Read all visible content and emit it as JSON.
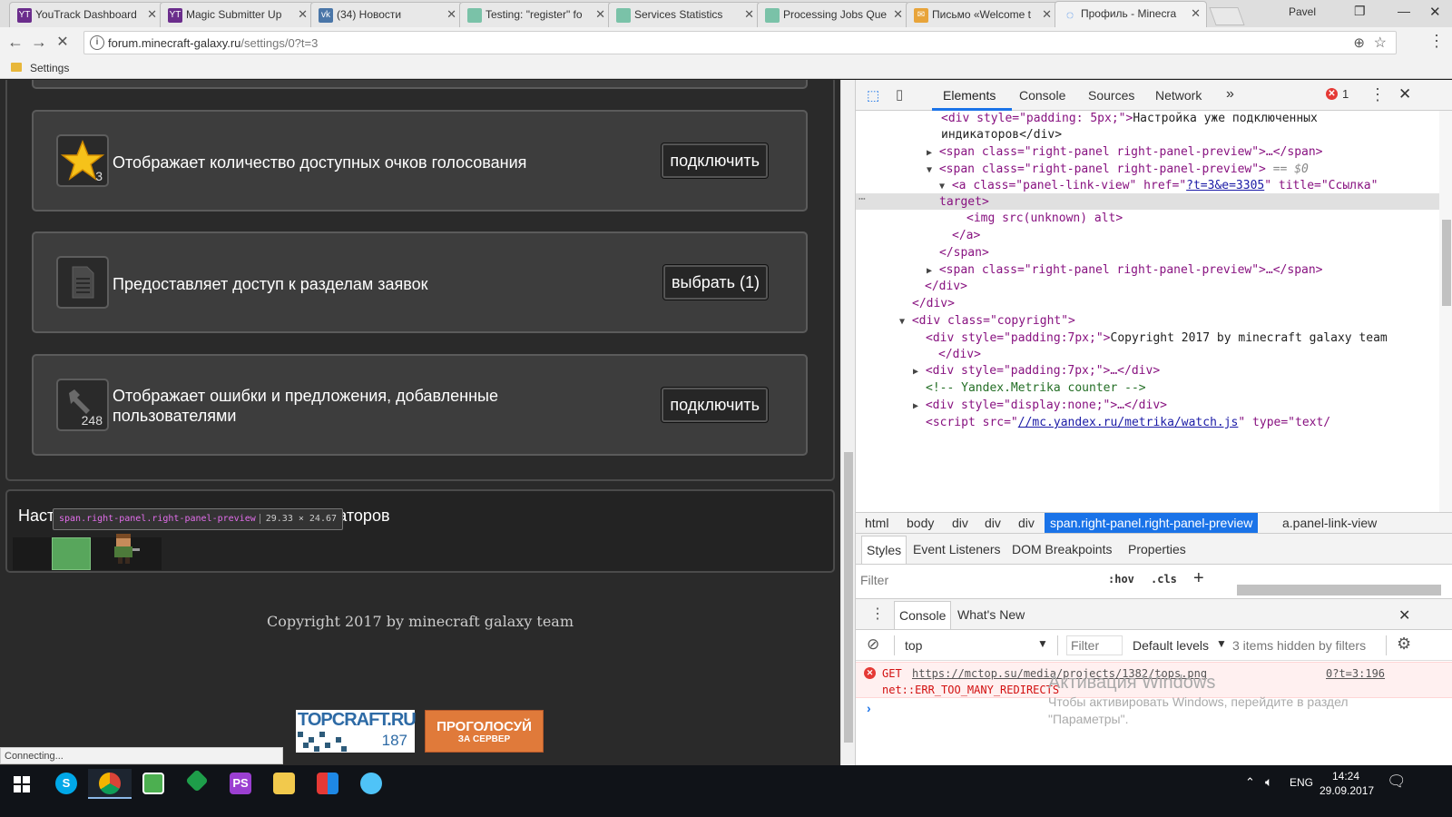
{
  "browser": {
    "tabs": [
      {
        "label": "YouTrack Dashboard",
        "icon": "youtrack-icon",
        "color": "#6b2d8c"
      },
      {
        "label": "Magic Submitter Up",
        "icon": "youtrack-icon",
        "color": "#6b2d8c"
      },
      {
        "label": "(34) Новости",
        "icon": "vk-icon",
        "color": "#4a76a8"
      },
      {
        "label": "Testing: \"register\" fo",
        "icon": "page-icon",
        "color": "#7ac2a8"
      },
      {
        "label": "Services Statistics",
        "icon": "page-icon",
        "color": "#7ac2a8"
      },
      {
        "label": "Processing Jobs Que",
        "icon": "page-icon",
        "color": "#7ac2a8"
      },
      {
        "label": "Письмо «Welcome t",
        "icon": "mail-icon",
        "color": "#e8a43a"
      },
      {
        "label": "Профиль - Minecra",
        "icon": "loading-icon",
        "color": "#1a73e8"
      }
    ],
    "user": "Pavel",
    "url_host": "forum.minecraft-galaxy.ru",
    "url_path": "/settings/0?t=3",
    "bookmark": "Settings"
  },
  "page": {
    "cards": [
      {
        "text": "Отображает количество доступных очков голосования",
        "button": "подключить",
        "icon": "star-icon",
        "badge": "3"
      },
      {
        "text": "Предоставляет доступ к разделам заявок",
        "button": "выбрать (1)",
        "icon": "document-icon",
        "badge": ""
      },
      {
        "text": "Отображает ошибки и предложения, добавленные пользователями",
        "button": "подключить",
        "icon": "wrench-icon",
        "badge": "248"
      }
    ],
    "settings_title_start": "Наст",
    "settings_title_end": "аторов",
    "tooltip_name": "span.right-panel.right-panel-preview",
    "tooltip_size": "29.33 × 24.67",
    "copyright": "Copyright 2017 by minecraft galaxy team",
    "topcraft_label": "TOPCRAFT.RU",
    "topcraft_count": "187",
    "vote_label": "ПРОГОЛОСУЙ",
    "vote_sub": "ЗА СЕРВЕР",
    "status": "Connecting..."
  },
  "devtools": {
    "tabs": [
      "Elements",
      "Console",
      "Sources",
      "Network"
    ],
    "error_count": "1",
    "dom": {
      "l1a": "<div style=\"padding: 5px;\">",
      "l1b": "Настройка уже подключенных",
      "l1c": "индикаторов</div>",
      "span_open": "<span class=\"right-panel right-panel-preview\">",
      "ellipsis": "…</span>",
      "sel_eq": "== $0",
      "a_open_1": "<a class=\"panel-link-view\" href=\"",
      "a_href": "?t=3&e=3305",
      "a_open_2": "\" title=\"Ссылка\"",
      "a_target": "target>",
      "img": "<img src(unknown) alt>",
      "a_close": "</a>",
      "span_close": "</span>",
      "div_close": "</div>",
      "copy_open": "<div class=\"copyright\">",
      "pad7": "<div style=\"padding:7px;\">",
      "copy_text": "Copyright 2017 by minecraft galaxy team",
      "pad7_close": "</div>",
      "pad7_collapsed": "<div style=\"padding:7px;\">…</div>",
      "comment": "<!-- Yandex.Metrika counter -->",
      "none_div": "<div style=\"display:none;\">…</div>",
      "script_1": "<script src=\"",
      "script_src": "//mc.yandex.ru/metrika/watch.js",
      "script_2": "\" type=\"text/"
    },
    "breadcrumbs": [
      "html",
      "body",
      "div",
      "div",
      "div",
      "span.right-panel.right-panel-preview",
      "a.panel-link-view"
    ],
    "style_tabs": [
      "Styles",
      "Event Listeners",
      "DOM Breakpoints",
      "Properties"
    ],
    "filter_placeholder": "Filter",
    "hov": ":hov",
    "cls": ".cls",
    "drawer_tabs": [
      "Console",
      "What's New"
    ],
    "context": "top",
    "console_filter": "Filter",
    "levels": "Default levels",
    "hidden": "3 items hidden by filters",
    "error_get": "GET",
    "error_url": "https://mctop.su/media/projects/1382/tops.png",
    "error_source": "0?t=3:196",
    "error_msg": "net::ERR_TOO_MANY_REDIRECTS",
    "activation_title": "Активация Windows",
    "activation_text1": "Чтобы активировать Windows, перейдите в раздел",
    "activation_text2": "\"Параметры\"."
  },
  "taskbar": {
    "lang": "ENG",
    "time": "14:24",
    "date": "29.09.2017"
  }
}
